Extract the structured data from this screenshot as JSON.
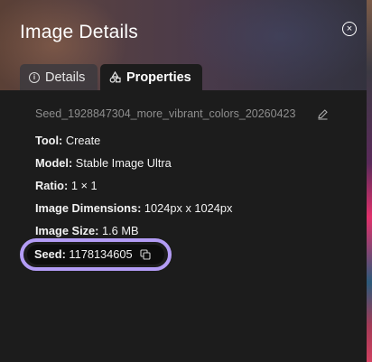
{
  "panel": {
    "title": "Image Details",
    "close_label": "×"
  },
  "tabs": [
    {
      "label": "Details",
      "icon": "info-icon",
      "active": false
    },
    {
      "label": "Properties",
      "icon": "shapes-icon",
      "active": true
    }
  ],
  "properties": {
    "filename": "Seed_1928847304_more_vibrant_colors_20260423",
    "tool_label": "Tool:",
    "tool_value": "Create",
    "model_label": "Model:",
    "model_value": "Stable Image Ultra",
    "ratio_label": "Ratio:",
    "ratio_value": "1 × 1",
    "dimensions_label": "Image Dimensions:",
    "dimensions_value": "1024px x 1024px",
    "size_label": "Image Size:",
    "size_value": "1.6 MB",
    "seed_label": "Seed:",
    "seed_value": "1178134605"
  },
  "colors": {
    "highlight_ring": "#b39cf5",
    "panel_bg": "#1c1c1c"
  }
}
